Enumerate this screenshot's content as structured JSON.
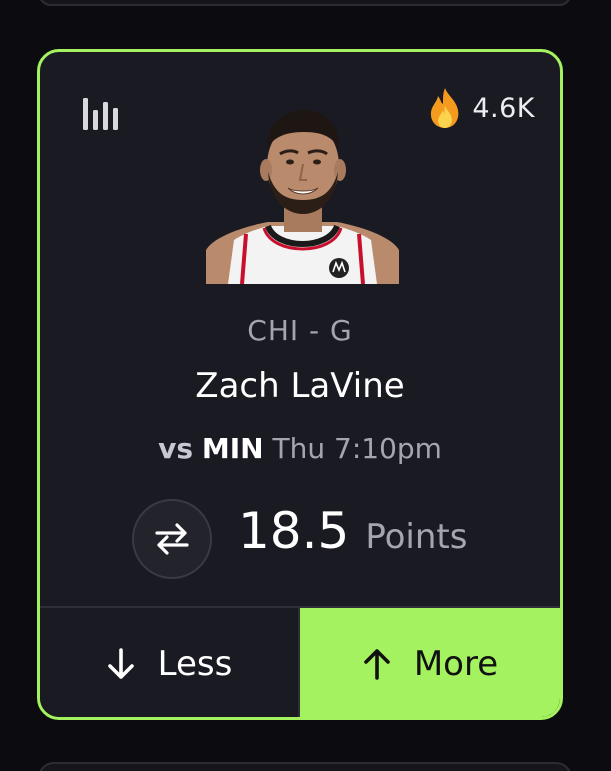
{
  "colors": {
    "accent": "#a4f25f",
    "card_bg": "#1a1a22",
    "page_bg": "#0b0b10",
    "muted_text": "#a5a5b0"
  },
  "card": {
    "stats_icon": "bar-chart-icon",
    "popularity": {
      "icon": "fire-icon",
      "count": "4.6K"
    },
    "player": {
      "team_position": "CHI - G",
      "name": "Zach LaVine"
    },
    "game": {
      "vs_label": "vs",
      "opponent": "MIN",
      "time": "Thu 7:10pm"
    },
    "projection": {
      "swap_icon": "swap-arrows-icon",
      "value": "18.5",
      "stat": "Points"
    },
    "picks": {
      "less_label": "Less",
      "more_label": "More",
      "selected": "More"
    }
  }
}
